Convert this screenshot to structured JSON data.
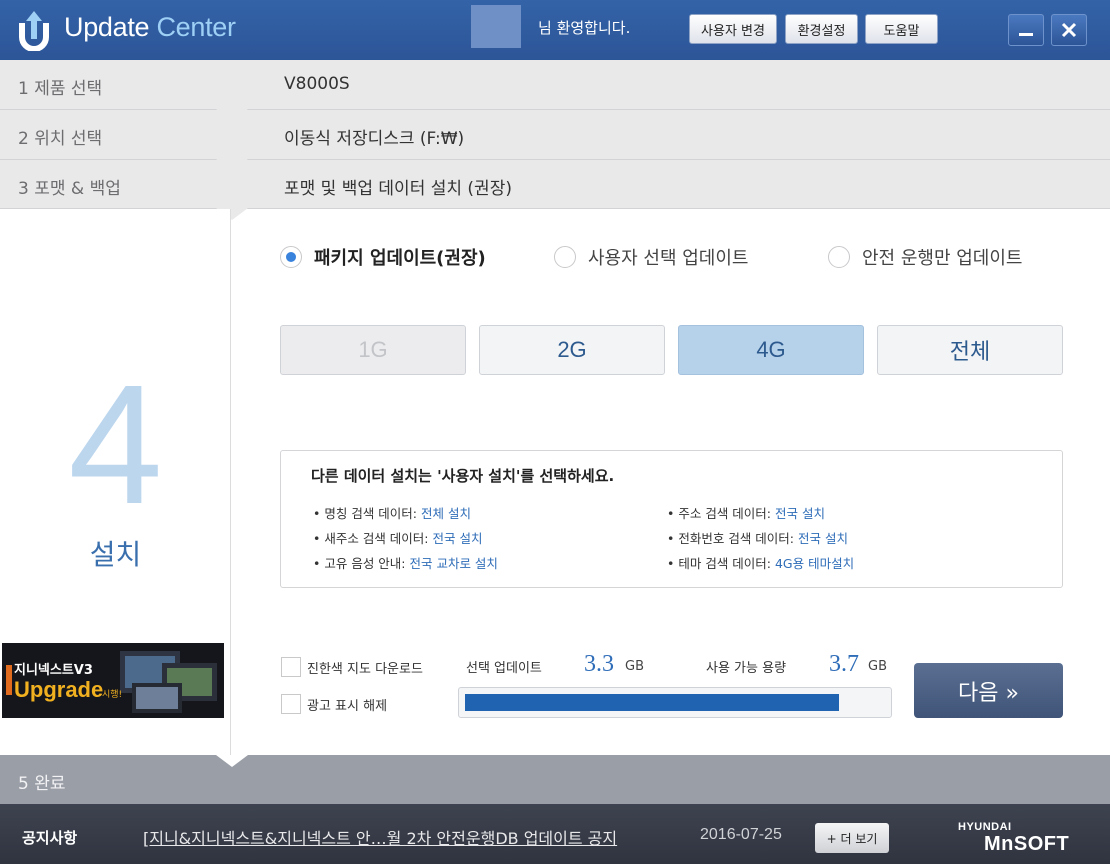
{
  "titlebar": {
    "app_name_primary": "Update",
    "app_name_secondary": "Center",
    "welcome": "님 환영합니다.",
    "buttons": {
      "change_user": "사용자 변경",
      "settings": "환경설정",
      "help": "도움말"
    },
    "colors": {
      "bar": "#2c5597",
      "accent": "#9ed0f5"
    }
  },
  "steps": [
    {
      "label": "1  제품 선택",
      "value": "V8000S"
    },
    {
      "label": "2  위치 선택",
      "value": "이동식 저장디스크 (F:₩)"
    },
    {
      "label": "3  포맷 & 백업",
      "value": "포맷 및 백업 데이터 설치 (권장)"
    }
  ],
  "current_step": {
    "number": "4",
    "name": "설치"
  },
  "banner": {
    "title": "지니넥스트V3",
    "subtitle": "Upgrade",
    "tag": "시행!"
  },
  "update_modes": [
    {
      "label": "패키지 업데이트(권장)",
      "selected": true
    },
    {
      "label": "사용자 선택 업데이트",
      "selected": false
    },
    {
      "label": "안전 운행만 업데이트",
      "selected": false
    }
  ],
  "sizes": [
    {
      "label": "1G",
      "state": "disabled"
    },
    {
      "label": "2G",
      "state": "normal"
    },
    {
      "label": "4G",
      "state": "selected"
    },
    {
      "label": "전체",
      "state": "normal"
    }
  ],
  "info": {
    "title": "다른 데이터 설치는 '사용자 설치'를 선택하세요.",
    "items": [
      {
        "name": "• 명칭 검색 데이터: ",
        "value": "전체 설치"
      },
      {
        "name": "• 주소 검색 데이터: ",
        "value": "전국 설치"
      },
      {
        "name": "• 새주소 검색 데이터: ",
        "value": "전국 설치"
      },
      {
        "name": "• 전화번호 검색 데이터: ",
        "value": "전국 설치"
      },
      {
        "name": "• 고유 음성 안내: ",
        "value": "전국 교차로 설치"
      },
      {
        "name": "• 테마 검색 데이터: ",
        "value": "4G용 테마설치"
      }
    ]
  },
  "options": {
    "offline_map": "진한색 지도 다운로드",
    "ad_disable": "광고 표시 해제"
  },
  "stats": {
    "selected_label": "선택 업데이트",
    "selected_value": "3.3",
    "selected_unit": "GB",
    "available_label": "사용 가능 용량",
    "available_value": "3.7",
    "available_unit": "GB",
    "usage_fraction": 0.89
  },
  "next_button": "다음 »",
  "final_step": "5  완료",
  "footer": {
    "notice_label": "공지사항",
    "notice_text": "[지니&지니넥스트&지니넥스트 안…월 2차 안전운행DB 업데이트 공지",
    "notice_date": "2016-07-25",
    "more": "+ 더 보기",
    "brand_top": "HYUNDAI",
    "brand_bottom": "MnSOFT"
  }
}
